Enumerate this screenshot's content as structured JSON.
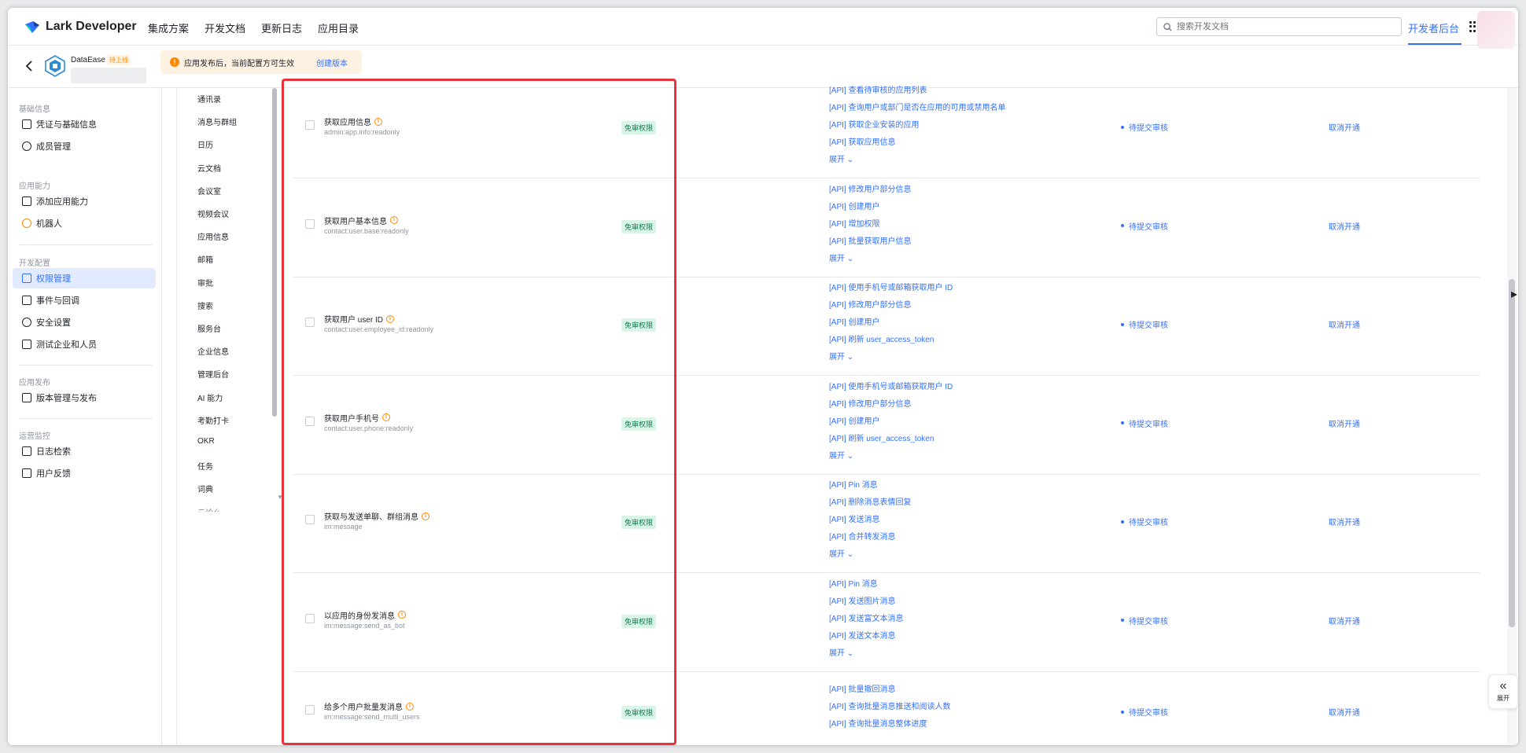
{
  "header": {
    "brand": "Lark Developer",
    "nav": [
      "集成方案",
      "开发文档",
      "更新日志",
      "应用目录"
    ],
    "search_placeholder": "搜索开发文档",
    "dev_backend": "开发者后台"
  },
  "app": {
    "name": "DataEase",
    "tag": "待上线"
  },
  "notice": {
    "text": "应用发布后，当前配置方可生效",
    "link": "创建版本"
  },
  "sidebar": {
    "groups": [
      {
        "title": "基础信息",
        "items": [
          {
            "label": "凭证与基础信息",
            "icon": "credential-icon"
          },
          {
            "label": "成员管理",
            "icon": "member-icon"
          }
        ]
      },
      {
        "title": "应用能力",
        "items": [
          {
            "label": "添加应用能力",
            "icon": "add-capability-icon"
          },
          {
            "label": "机器人",
            "icon": "robot-icon"
          }
        ]
      },
      {
        "title": "开发配置",
        "items": [
          {
            "label": "权限管理",
            "icon": "permission-icon",
            "active": true
          },
          {
            "label": "事件与回调",
            "icon": "event-icon"
          },
          {
            "label": "安全设置",
            "icon": "shield-icon"
          },
          {
            "label": "测试企业和人员",
            "icon": "test-icon"
          }
        ]
      },
      {
        "title": "应用发布",
        "items": [
          {
            "label": "版本管理与发布",
            "icon": "version-icon"
          }
        ]
      },
      {
        "title": "运营监控",
        "items": [
          {
            "label": "日志检索",
            "icon": "log-icon"
          },
          {
            "label": "用户反馈",
            "icon": "feedback-icon"
          }
        ]
      }
    ]
  },
  "categories": [
    "通讯录",
    "消息与群组",
    "日历",
    "云文档",
    "会议室",
    "视频会议",
    "应用信息",
    "邮箱",
    "审批",
    "搜索",
    "服务台",
    "企业信息",
    "管理后台",
    "AI 能力",
    "考勤打卡",
    "OKR",
    "任务",
    "词典",
    "云论么"
  ],
  "permissions": [
    {
      "name": "获取应用信息",
      "code": "admin:app.info:readonly",
      "badge": "免审权限",
      "apis": [
        "[API] 查看待审核的应用列表",
        "[API] 查询用户或部门是否在应用的可用或禁用名单",
        "[API] 获取企业安装的应用",
        "[API] 获取应用信息"
      ],
      "expand": "展开",
      "status": "待提交审核",
      "action": "取消开通"
    },
    {
      "name": "获取用户基本信息",
      "code": "contact:user.base:readonly",
      "badge": "免审权限",
      "apis": [
        "[API] 修改用户部分信息",
        "[API] 创建用户",
        "[API] 增加权限",
        "[API] 批量获取用户信息"
      ],
      "expand": "展开",
      "status": "待提交审核",
      "action": "取消开通"
    },
    {
      "name": "获取用户 user ID",
      "code": "contact:user.employee_id:readonly",
      "badge": "免审权限",
      "apis": [
        "[API] 使用手机号或邮箱获取用户 ID",
        "[API] 修改用户部分信息",
        "[API] 创建用户",
        "[API] 刷新 user_access_token"
      ],
      "expand": "展开",
      "status": "待提交审核",
      "action": "取消开通"
    },
    {
      "name": "获取用户手机号",
      "code": "contact:user.phone:readonly",
      "badge": "免审权限",
      "apis": [
        "[API] 使用手机号或邮箱获取用户 ID",
        "[API] 修改用户部分信息",
        "[API] 创建用户",
        "[API] 刷新 user_access_token"
      ],
      "expand": "展开",
      "status": "待提交审核",
      "action": "取消开通"
    },
    {
      "name": "获取与发送单聊、群组消息",
      "code": "im:message",
      "badge": "免审权限",
      "apis": [
        "[API] Pin 消息",
        "[API] 删除消息表情回复",
        "[API] 发送消息",
        "[API] 合并转发消息"
      ],
      "expand": "展开",
      "status": "待提交审核",
      "action": "取消开通"
    },
    {
      "name": "以应用的身份发消息",
      "code": "im:message:send_as_bot",
      "badge": "免审权限",
      "apis": [
        "[API] Pin 消息",
        "[API] 发送图片消息",
        "[API] 发送富文本消息",
        "[API] 发送文本消息"
      ],
      "expand": "展开",
      "status": "待提交审核",
      "action": "取消开通"
    },
    {
      "name": "给多个用户批量发消息",
      "code": "im:message:send_multi_users",
      "badge": "免审权限",
      "apis": [
        "[API] 批量撤回消息",
        "[API] 查询批量消息推送和阅读人数",
        "[API] 查询批量消息整体进度"
      ],
      "expand": "",
      "status": "待提交审核",
      "action": "取消开通"
    }
  ],
  "collapse_button": {
    "label": "展开"
  },
  "colors": {
    "accent": "#3370ff",
    "highlight_box": "#e8333d",
    "badge_bg": "#d9f5e7",
    "warning": "#ff8800"
  }
}
